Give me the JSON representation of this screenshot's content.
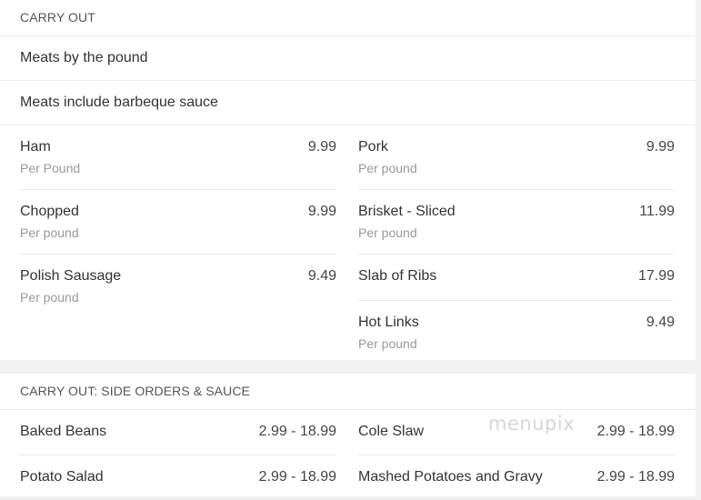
{
  "carry_out": {
    "header": "CARRY OUT",
    "subtitle_1": "Meats by the pound",
    "subtitle_2": "Meats include barbeque sauce",
    "left_items": [
      {
        "name": "Ham",
        "price": "9.99",
        "desc": "Per Pound"
      },
      {
        "name": "Chopped",
        "price": "9.99",
        "desc": "Per pound"
      },
      {
        "name": "Polish Sausage",
        "price": "9.49",
        "desc": "Per pound"
      }
    ],
    "right_items": [
      {
        "name": "Pork",
        "price": "9.99",
        "desc": "Per pound"
      },
      {
        "name": "Brisket - Sliced",
        "price": "11.99",
        "desc": "Per pound"
      },
      {
        "name": "Slab of Ribs",
        "price": "17.99",
        "desc": ""
      },
      {
        "name": "Hot Links",
        "price": "9.49",
        "desc": "Per pound"
      }
    ]
  },
  "sides": {
    "header": "CARRY OUT: SIDE ORDERS & SAUCE",
    "left_items": [
      {
        "name": "Baked Beans",
        "price": "2.99 - 18.99"
      },
      {
        "name": "Potato Salad",
        "price": "2.99 - 18.99"
      }
    ],
    "right_items": [
      {
        "name": "Cole Slaw",
        "price": "2.99 - 18.99"
      },
      {
        "name": "Mashed Potatoes and Gravy",
        "price": "2.99 - 18.99"
      }
    ]
  },
  "watermark": "menupix"
}
